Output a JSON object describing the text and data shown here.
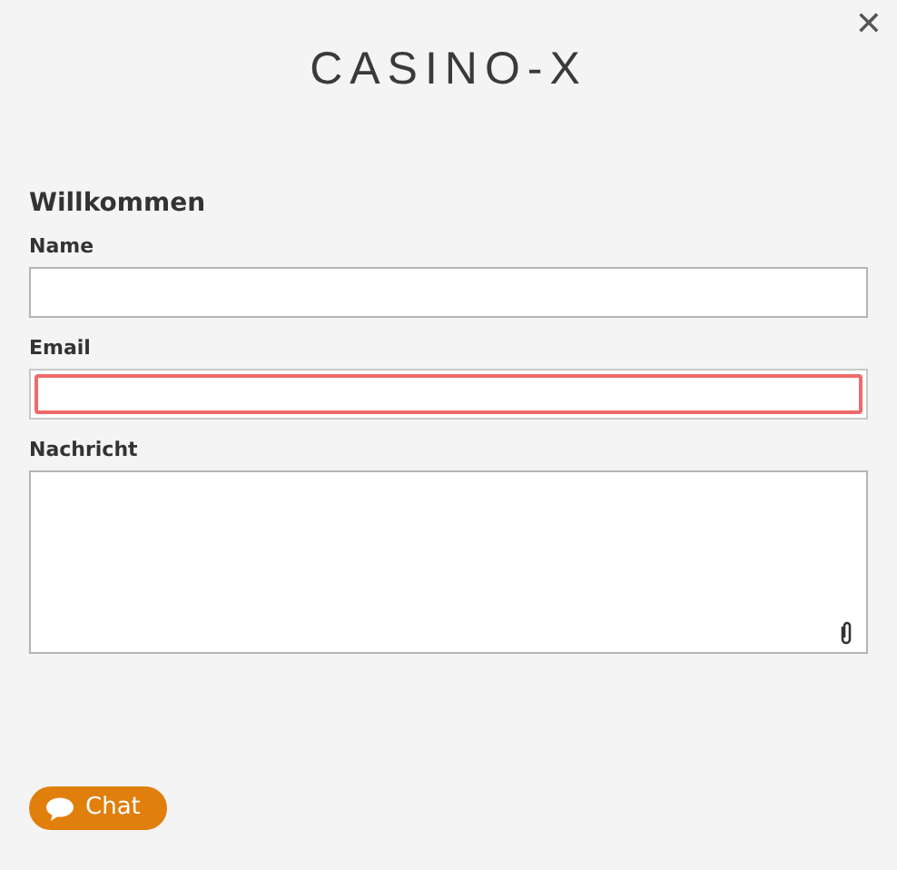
{
  "logo": "CASINO-X",
  "close": "✕",
  "title": "Willkommen",
  "fields": [
    {
      "label": "Name",
      "kind": "input",
      "invalid": false
    },
    {
      "label": "Email",
      "kind": "input",
      "invalid": true
    },
    {
      "label": "Nachricht",
      "kind": "textarea",
      "invalid": false
    }
  ],
  "chat_button": "Chat"
}
